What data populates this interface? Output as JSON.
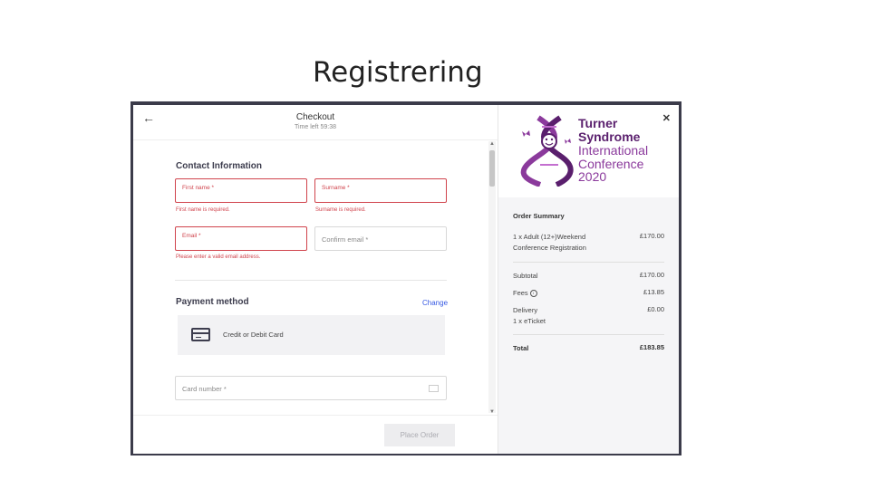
{
  "slide": {
    "title": "Registrering"
  },
  "checkout": {
    "title": "Checkout",
    "time_left": "Time left 59:38",
    "contact_heading": "Contact Information",
    "first_name_label": "First name *",
    "first_name_error": "First name is required.",
    "surname_label": "Surname *",
    "surname_error": "Surname is required.",
    "email_label": "Email *",
    "email_error": "Please enter a valid email address.",
    "confirm_email_placeholder": "Confirm email *",
    "payment_heading": "Payment method",
    "change_link": "Change",
    "payment_option": "Credit or Debit Card",
    "card_number_placeholder": "Card number *",
    "place_order": "Place Order"
  },
  "brand": {
    "line1": "Turner",
    "line2": "Syndrome",
    "line3": "International",
    "line4": "Conference",
    "line5": "2020"
  },
  "summary": {
    "title": "Order Summary",
    "item_line1": "1 x Adult (12+)Weekend",
    "item_line2": "Conference Registration",
    "item_price": "£170.00",
    "subtotal_label": "Subtotal",
    "subtotal_value": "£170.00",
    "fees_label": "Fees",
    "fees_value": "£13.85",
    "delivery_label": "Delivery",
    "delivery_sub": "1 x eTicket",
    "delivery_value": "£0.00",
    "total_label": "Total",
    "total_value": "£183.85"
  },
  "colors": {
    "error": "#d0434c",
    "link": "#3659e3",
    "brand_dark": "#5a1f6d",
    "brand_light": "#8b3a9c"
  }
}
